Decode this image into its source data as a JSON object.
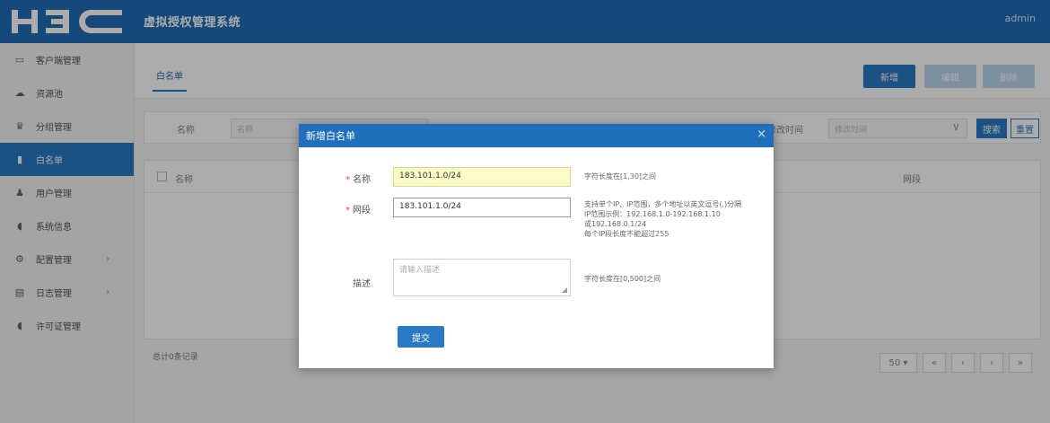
{
  "header": {
    "logo": "H3C",
    "title": "虚拟授权管理系统",
    "user": "admin"
  },
  "sidebar": {
    "items": [
      {
        "label": "客户端管理",
        "icon": "monitor-icon",
        "glyph": "▭"
      },
      {
        "label": "资源池",
        "icon": "cloud-icon",
        "glyph": "☁"
      },
      {
        "label": "分组管理",
        "icon": "group-icon",
        "glyph": "♛"
      },
      {
        "label": "白名单",
        "icon": "file-icon",
        "glyph": "▮"
      },
      {
        "label": "用户管理",
        "icon": "user-icon",
        "glyph": "♟"
      },
      {
        "label": "系统信息",
        "icon": "shield-icon",
        "glyph": "◖"
      },
      {
        "label": "配置管理",
        "icon": "gear-icon",
        "glyph": "⚙",
        "arrow": "›"
      },
      {
        "label": "日志管理",
        "icon": "calendar-icon",
        "glyph": "▤",
        "arrow": "›"
      },
      {
        "label": "许可证管理",
        "icon": "license-icon",
        "glyph": "◖"
      }
    ]
  },
  "main": {
    "tab": "白名单",
    "buttons": {
      "add": "新增",
      "edit": "编辑",
      "delete": "删除"
    },
    "filter": {
      "name_label": "名称",
      "name_placeholder": "名称",
      "time_label": "修改时间",
      "time_placeholder": "修改时间",
      "search": "搜索",
      "reset": "重置"
    },
    "table": {
      "col_name": "名称",
      "col_segment": "网段"
    },
    "total": "总计0条记录",
    "pager": {
      "page_size": "50 ▾",
      "first": "«",
      "prev": "‹",
      "next": "›",
      "last": "»"
    }
  },
  "modal": {
    "title": "新增白名单",
    "close": "×",
    "name_label": "名称",
    "name_value": "183.101.1.0/24",
    "name_hint": "字符长度在[1,30]之间",
    "segment_label": "网段",
    "segment_value": "183.101.1.0/24",
    "segment_hint": [
      "支持单个IP、IP范围，多个地址以英文逗号(,)分隔",
      "IP范围示例：192.168.1.0-192.168.1.10",
      "或192.168.0.1/24",
      "每个IP段长度不能超过255"
    ],
    "desc_label": "描述",
    "desc_placeholder": "请输入描述",
    "desc_hint": "字符长度在[0,500]之间",
    "submit": "提交"
  },
  "colors": {
    "brand": "#1e6db5",
    "active": "#2a79c4",
    "required": "#e3463c",
    "autofill": "#fbfbc9"
  }
}
